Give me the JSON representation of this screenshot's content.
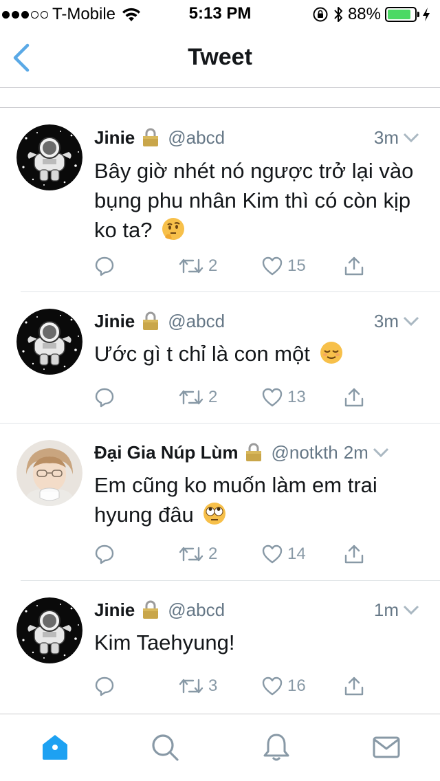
{
  "status_bar": {
    "carrier": "T-Mobile",
    "time": "5:13 PM",
    "battery": "88%",
    "battery_level": 0.88
  },
  "nav": {
    "title": "Tweet"
  },
  "tweets": [
    {
      "name": "Jinie",
      "handle": "@abcd",
      "time": "3m",
      "text": "Bây giờ nhét nó ngược trở lại vào bụng phu nhân Kim thì có còn kịp ko ta?",
      "emoji": "thinking-face",
      "retweets": "2",
      "likes": "15"
    },
    {
      "name": "Jinie",
      "handle": "@abcd",
      "time": "3m",
      "text": "Ước gì t chỉ là con một",
      "emoji": "relieved-face",
      "retweets": "2",
      "likes": "13"
    },
    {
      "name": "Đại Gia Núp Lùm",
      "handle": "@notkth",
      "time": "2m",
      "text": "Em cũng ko muốn làm em trai hyung đâu",
      "emoji": "rolling-eyes-face",
      "retweets": "2",
      "likes": "14"
    },
    {
      "name": "Jinie",
      "handle": "@abcd",
      "time": "1m",
      "text": "Kim Taehyung!",
      "emoji": "",
      "retweets": "3",
      "likes": "16"
    }
  ],
  "colors": {
    "accent": "#1da1f2",
    "back": "#5aa9e6",
    "secondary": "#657786",
    "action": "#8899a6"
  },
  "tabs": [
    "home-icon",
    "search-icon",
    "notifications-icon",
    "messages-icon"
  ]
}
